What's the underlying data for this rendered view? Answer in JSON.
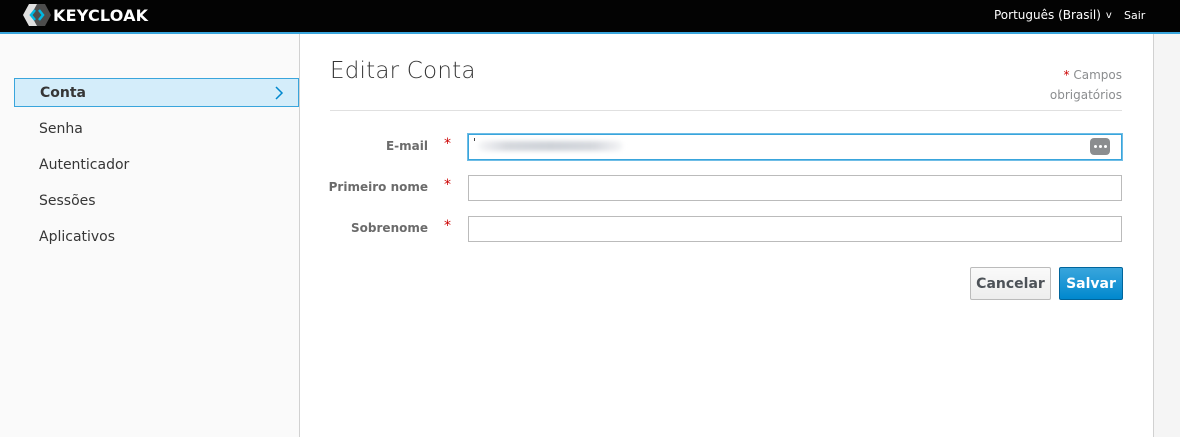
{
  "header": {
    "brand_text": "KEYCLOAK",
    "language_label": "Português (Brasil)",
    "language_chevron": "v",
    "signout_label": "Sair"
  },
  "sidebar": {
    "items": [
      {
        "label": "Conta",
        "active": true
      },
      {
        "label": "Senha",
        "active": false
      },
      {
        "label": "Autenticador",
        "active": false
      },
      {
        "label": "Sessões",
        "active": false
      },
      {
        "label": "Aplicativos",
        "active": false
      }
    ]
  },
  "main": {
    "title": "Editar Conta",
    "required_star": "*",
    "required_line1": "Campos",
    "required_line2": "obrigatórios"
  },
  "form": {
    "required_marker": "*",
    "email": {
      "label": "E-mail",
      "value": ""
    },
    "first_name": {
      "label": "Primeiro nome",
      "value": ""
    },
    "last_name": {
      "label": "Sobrenome",
      "value": ""
    }
  },
  "buttons": {
    "cancel_label": "Cancelar",
    "save_label": "Salvar"
  },
  "colors": {
    "topbar": "#030303",
    "accent": "#39a5dc",
    "primary_button": "#0088ce",
    "required": "#cc0000"
  },
  "icons": {
    "logo": "keycloak-logo-icon",
    "nav_arrow": "chevron-right-icon",
    "password_manager": "password-manager-icon"
  }
}
